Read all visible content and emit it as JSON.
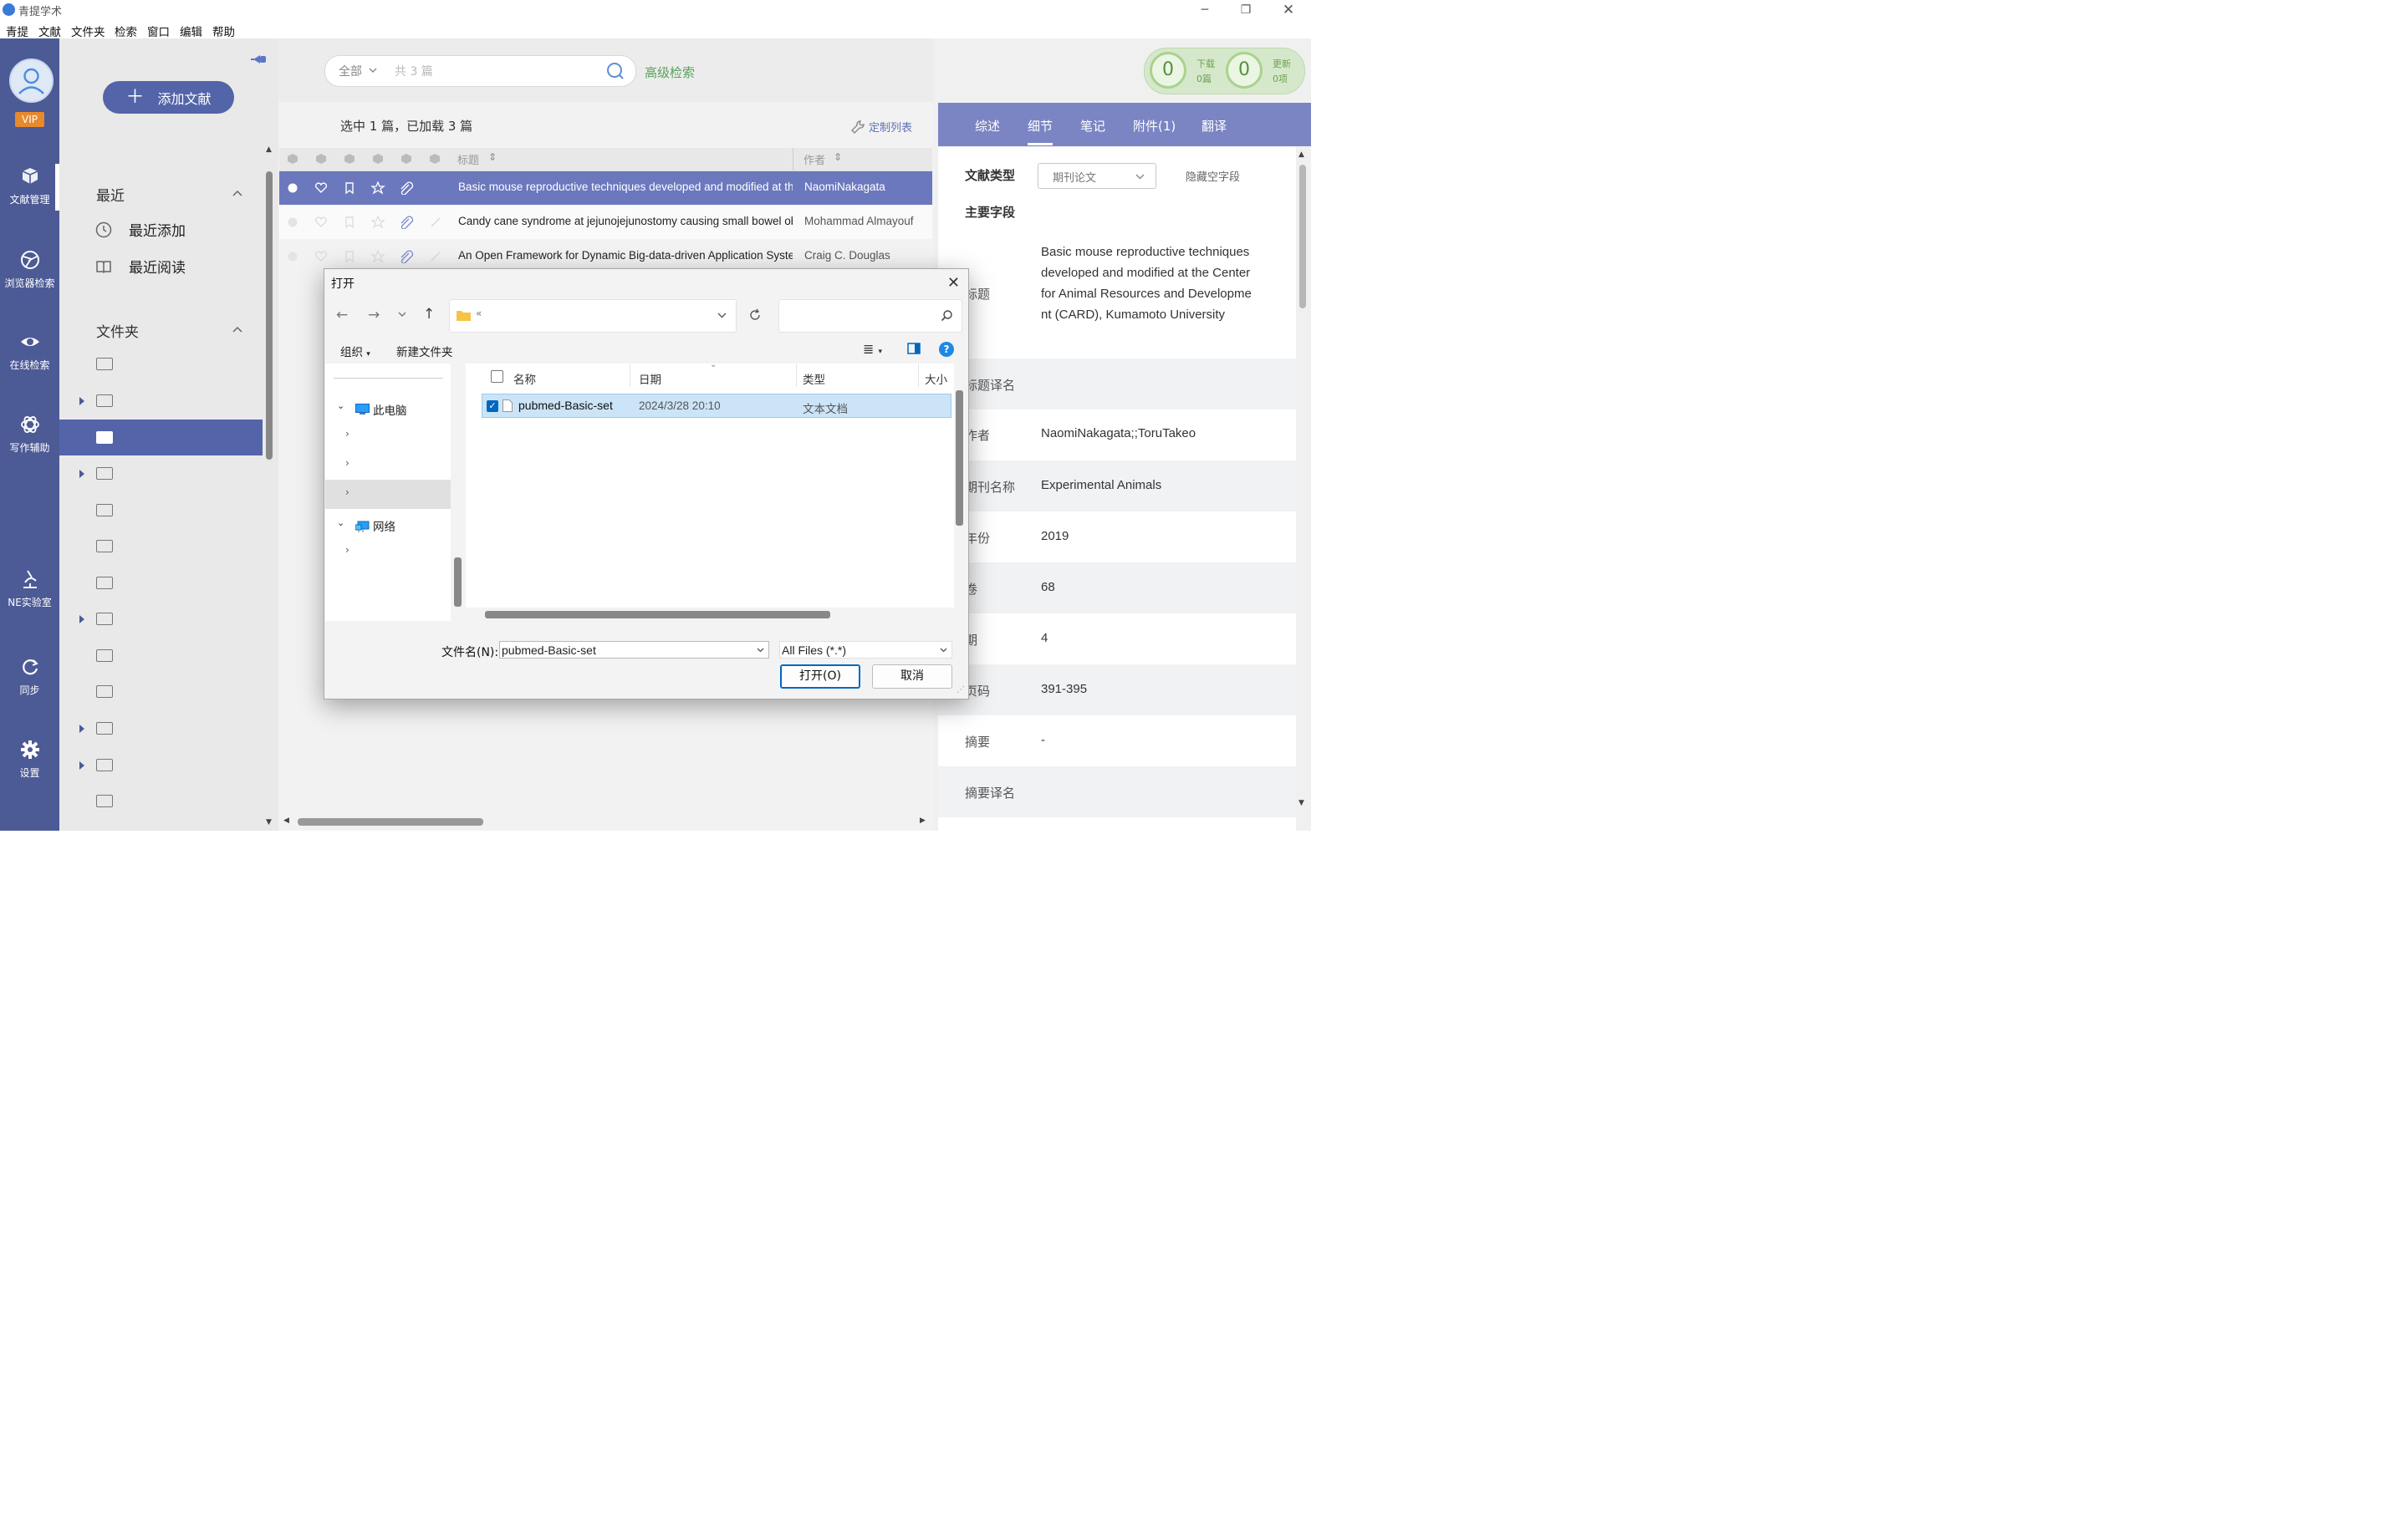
{
  "window": {
    "title": "青提学术",
    "controls": [
      "minimize-icon",
      "restore-icon",
      "close-icon"
    ]
  },
  "menu": [
    "青提",
    "文献",
    "文件夹",
    "检索",
    "窗口",
    "编辑",
    "帮助"
  ],
  "leftnav": {
    "vip": "VIP",
    "items": [
      {
        "label": "文献管理",
        "icon": "library-icon"
      },
      {
        "label": "浏览器检索",
        "icon": "browser-icon"
      },
      {
        "label": "在线检索",
        "icon": "eye-icon"
      },
      {
        "label": "写作辅助",
        "icon": "ai-icon"
      },
      {
        "label": "NE实验室",
        "icon": "microscope-icon"
      },
      {
        "label": "同步",
        "icon": "sync-icon"
      },
      {
        "label": "设置",
        "icon": "gear-icon"
      }
    ],
    "selected": "文献管理"
  },
  "folders": {
    "add_button": "添加文献",
    "recent_title": "最近",
    "recent_items": [
      "最近添加",
      "最近阅读"
    ],
    "folder_title": "文件夹"
  },
  "list": {
    "scope": "全部",
    "placeholder": "共 3 篇",
    "advanced": "高级检索",
    "status": "选中 1 篇，已加载 3 篇",
    "customize": "定制列表",
    "col_title": "标题",
    "col_author": "作者",
    "rows": [
      {
        "title": "Basic mouse reproductive techniques developed and modified at the Center for Animal Resources and Development (CARD), Kumamoto University",
        "author": "NaomiNakagata",
        "selected": true
      },
      {
        "title": "Candy cane syndrome at jejunojejunostomy causing small bowel obstruction",
        "author": "Mohammad Almayouf",
        "selected": false
      },
      {
        "title": "An Open Framework for Dynamic Big-data-driven Application Systems",
        "author": "Craig C. Douglas",
        "selected": false
      }
    ]
  },
  "counters": {
    "download_count": "0",
    "download_label": "下载",
    "download_sub": "0篇",
    "update_count": "0",
    "update_label": "更新",
    "update_sub": "0项"
  },
  "detail": {
    "tabs": [
      "综述",
      "细节",
      "笔记",
      "附件(1)",
      "翻译"
    ],
    "active_tab": "细节",
    "type_label": "文献类型",
    "type_value": "期刊论文",
    "hide_empty": "隐藏空字段",
    "main_fields": "主要字段",
    "title_label": "标题",
    "title_value": "Basic mouse reproductive techniques developed and modified at the Center for Animal Resources and Development (CARD), Kumamoto University",
    "title_trans_label": "标题译名",
    "author_label": "作者",
    "author_value": "NaomiNakagata;;ToruTakeo",
    "journal_label": "期刊名称",
    "journal_value": "Experimental Animals",
    "year_label": "年份",
    "year_value": "2019",
    "volume_label": "卷",
    "volume_value": "68",
    "issue_label": "期",
    "issue_value": "4",
    "pages_label": "页码",
    "pages_value": "391-395",
    "abstract_label": "摘要",
    "abstract_value": "-",
    "abstract_trans_label": "摘要译名"
  },
  "dialog": {
    "title": "打开",
    "address": "«",
    "organize": "组织",
    "new_folder": "新建文件夹",
    "tree": [
      {
        "label": "此电脑",
        "icon": "computer-icon"
      },
      {
        "label": "网络",
        "icon": "network-icon"
      }
    ],
    "columns": [
      "名称",
      "日期",
      "类型",
      "大小"
    ],
    "file": {
      "name": "pubmed-Basic-set",
      "date": "2024/3/28 20:10",
      "type": "文本文档"
    },
    "filename_label": "文件名(N):",
    "filename_value": "pubmed-Basic-set",
    "filter": "All Files (*.*)",
    "open": "打开(O)",
    "cancel": "取消"
  },
  "colors": {
    "nav": "#4c5a96",
    "accent": "#5364a9",
    "tabs": "#7b85c3",
    "green": "#55a35a",
    "selected_row": "#6c78bd"
  }
}
